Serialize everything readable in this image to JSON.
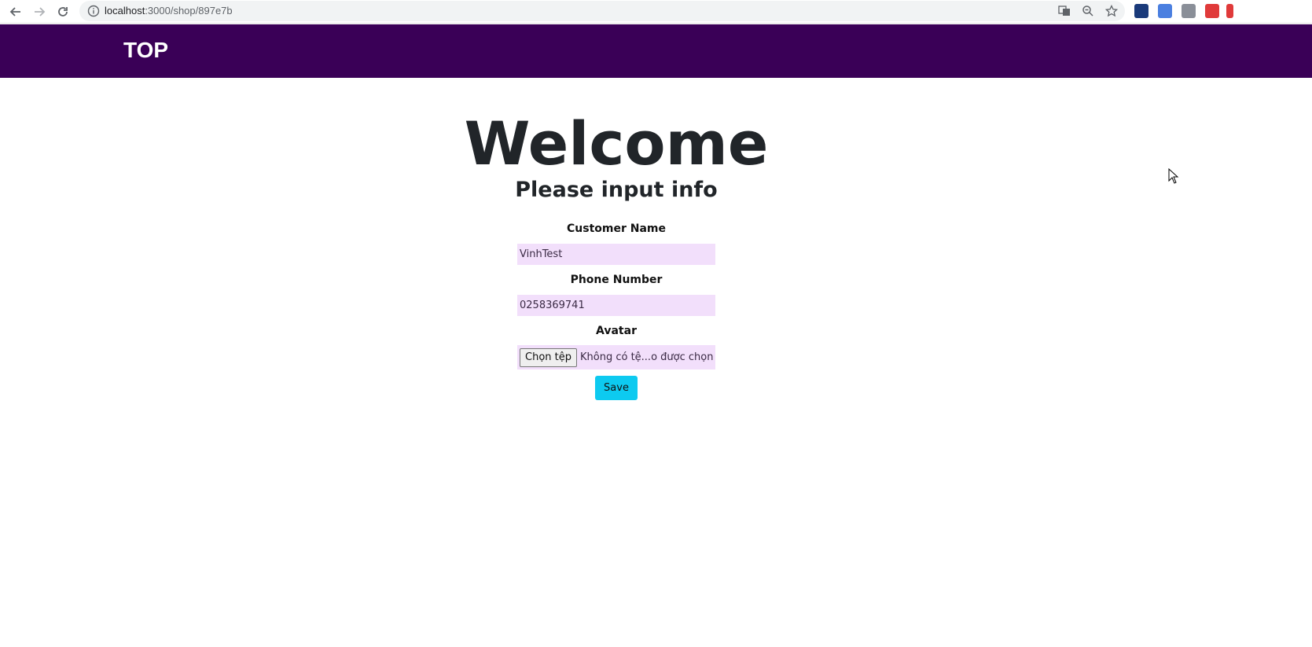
{
  "browser": {
    "url_host": "localhost",
    "url_path": ":3000/shop/897e7b"
  },
  "navbar": {
    "brand": "TOP",
    "color": "#3a0057"
  },
  "main": {
    "title": "Welcome",
    "subtitle": "Please input info"
  },
  "form": {
    "customer_name_label": "Customer Name",
    "customer_name_value": "VinhTest",
    "phone_label": "Phone Number",
    "phone_value": "0258369741",
    "avatar_label": "Avatar",
    "file_button": "Chọn tệp",
    "file_status": "Không có tệ...o được chọn",
    "save_button": "Save"
  },
  "colors": {
    "input_bg": "#f2dffb",
    "save_bg": "#0dcaf0"
  },
  "icons": [
    "back-arrow-icon",
    "forward-arrow-icon",
    "reload-icon",
    "info-icon",
    "translate-icon",
    "zoom-out-icon",
    "star-icon",
    "extension-icon",
    "cursor-icon"
  ]
}
